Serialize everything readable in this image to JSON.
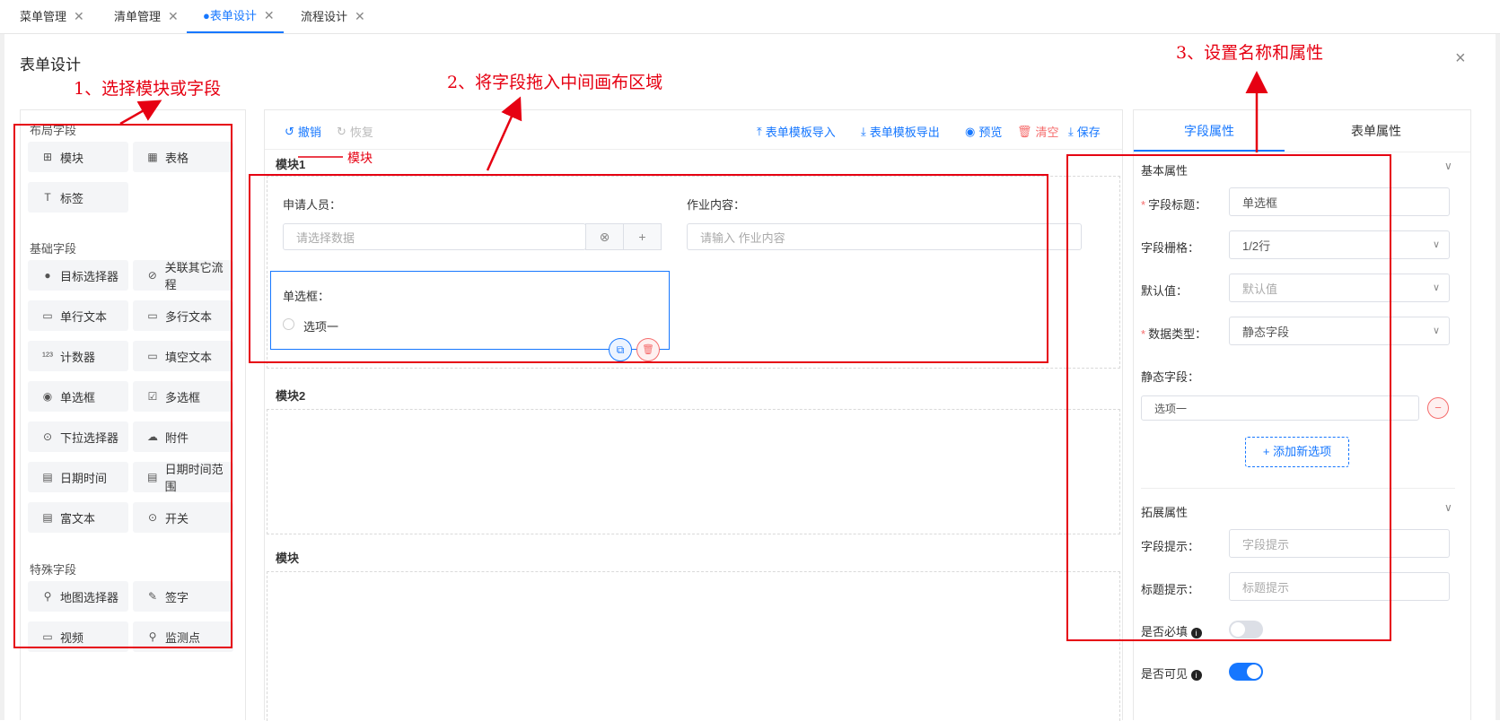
{
  "tabs": [
    {
      "label": "菜单管理",
      "active": false
    },
    {
      "label": "清单管理",
      "active": false
    },
    {
      "label": "●表单设计",
      "active": true
    },
    {
      "label": "流程设计",
      "active": false
    }
  ],
  "dialog": {
    "title": "表单设计",
    "close": "×"
  },
  "palette": {
    "layout_title": "布局字段",
    "layout_items": [
      {
        "icon": "grid-icon",
        "glyph": "⊞",
        "label": "模块"
      },
      {
        "icon": "table-icon",
        "glyph": "▦",
        "label": "表格"
      },
      {
        "icon": "tag-icon",
        "glyph": "T",
        "label": "标签"
      }
    ],
    "basic_title": "基础字段",
    "basic_items": [
      {
        "icon": "user-icon",
        "glyph": "●",
        "label": "目标选择器"
      },
      {
        "icon": "link-icon",
        "glyph": "⊘",
        "label": "关联其它流程"
      },
      {
        "icon": "single-text-icon",
        "glyph": "▭",
        "label": "单行文本"
      },
      {
        "icon": "multi-text-icon",
        "glyph": "▭",
        "label": "多行文本"
      },
      {
        "icon": "counter-icon",
        "glyph": "¹²³",
        "label": "计数器"
      },
      {
        "icon": "fill-text-icon",
        "glyph": "▭",
        "label": "填空文本"
      },
      {
        "icon": "radio-icon",
        "glyph": "◉",
        "label": "单选框"
      },
      {
        "icon": "checkbox-icon",
        "glyph": "☑",
        "label": "多选框"
      },
      {
        "icon": "dropdown-icon",
        "glyph": "⊙",
        "label": "下拉选择器"
      },
      {
        "icon": "cloud-icon",
        "glyph": "☁",
        "label": "附件"
      },
      {
        "icon": "calendar-icon",
        "glyph": "▤",
        "label": "日期时间"
      },
      {
        "icon": "calendar-range-icon",
        "glyph": "▤",
        "label": "日期时间范围"
      },
      {
        "icon": "richtext-icon",
        "glyph": "▤",
        "label": "富文本"
      },
      {
        "icon": "toggle-icon",
        "glyph": "⊙",
        "label": "开关"
      }
    ],
    "special_title": "特殊字段",
    "special_items": [
      {
        "icon": "map-pin-icon",
        "glyph": "⚲",
        "label": "地图选择器"
      },
      {
        "icon": "signature-icon",
        "glyph": "✎",
        "label": "签字"
      },
      {
        "icon": "video-icon",
        "glyph": "▭",
        "label": "视频"
      },
      {
        "icon": "monitor-point-icon",
        "glyph": "⚲",
        "label": "监测点"
      }
    ]
  },
  "toolbar": {
    "undo": "撤销",
    "redo": "恢复",
    "import": "表单模板导入",
    "export": "表单模板导出",
    "preview": "预览",
    "clear": "清空",
    "save": "保存"
  },
  "canvas": {
    "module1_title": "模块1",
    "applicant_label": "申请人员：",
    "applicant_placeholder": "请选择数据",
    "work_label": "作业内容：",
    "work_placeholder": "请输入 作业内容",
    "radio_label": "单选框：",
    "radio_option": "选项一",
    "module2_title": "模块2",
    "module3_title": "模块"
  },
  "right": {
    "tab_field": "字段属性",
    "tab_form": "表单属性",
    "basic_section": "基本属性",
    "field_title_label": "字段标题：",
    "field_title_value": "单选框",
    "grid_label": "字段栅格：",
    "grid_value": "1/2行",
    "default_label": "默认值：",
    "default_placeholder": "默认值",
    "datatype_label": "数据类型：",
    "datatype_value": "静态字段",
    "static_label": "静态字段：",
    "static_option": "选项一",
    "add_option": "+ 添加新选项",
    "ext_section": "拓展属性",
    "hint_label": "字段提示：",
    "hint_placeholder": "字段提示",
    "title_hint_label": "标题提示：",
    "title_hint_placeholder": "标题提示",
    "required_label": "是否必填",
    "required_on": false,
    "visible_label": "是否可见",
    "visible_on": true
  },
  "annotations": {
    "step1": "1、选择模块或字段",
    "step2": "2、将字段拖入中间画布区域",
    "step3": "3、设置名称和属性",
    "module_note": "模块"
  },
  "colors": {
    "accent": "#1677ff",
    "danger": "#f56c6c",
    "annotation": "#e60012"
  }
}
